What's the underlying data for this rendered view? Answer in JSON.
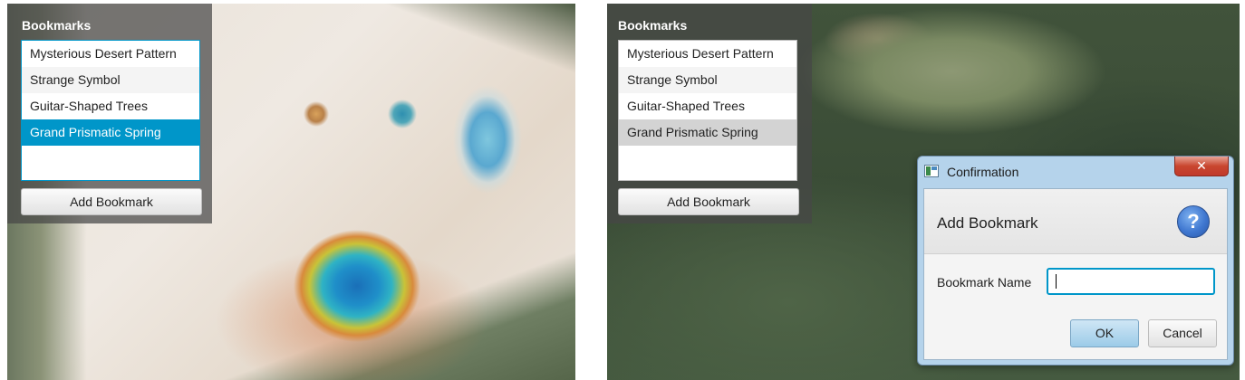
{
  "left": {
    "panel_title": "Bookmarks",
    "bookmarks": [
      "Mysterious Desert Pattern",
      "Strange Symbol",
      "Guitar-Shaped Trees",
      "Grand Prismatic Spring"
    ],
    "selected": "Grand Prismatic Spring",
    "add_button": "Add Bookmark"
  },
  "right": {
    "panel_title": "Bookmarks",
    "bookmarks": [
      "Mysterious Desert Pattern",
      "Strange Symbol",
      "Guitar-Shaped Trees",
      "Grand Prismatic Spring"
    ],
    "selected": "Grand Prismatic Spring",
    "add_button": "Add Bookmark"
  },
  "dialog": {
    "title": "Confirmation",
    "close_glyph": "✕",
    "heading": "Add Bookmark",
    "help_glyph": "?",
    "field_label": "Bookmark Name",
    "field_value": "",
    "ok": "OK",
    "cancel": "Cancel"
  },
  "colors": {
    "selection_focused": "#0096c9",
    "selection_unfocused": "#d3d3d3",
    "dialog_frame": "#b5d3eb",
    "close_button": "#c9462f",
    "help_icon": "#3f77d0"
  }
}
